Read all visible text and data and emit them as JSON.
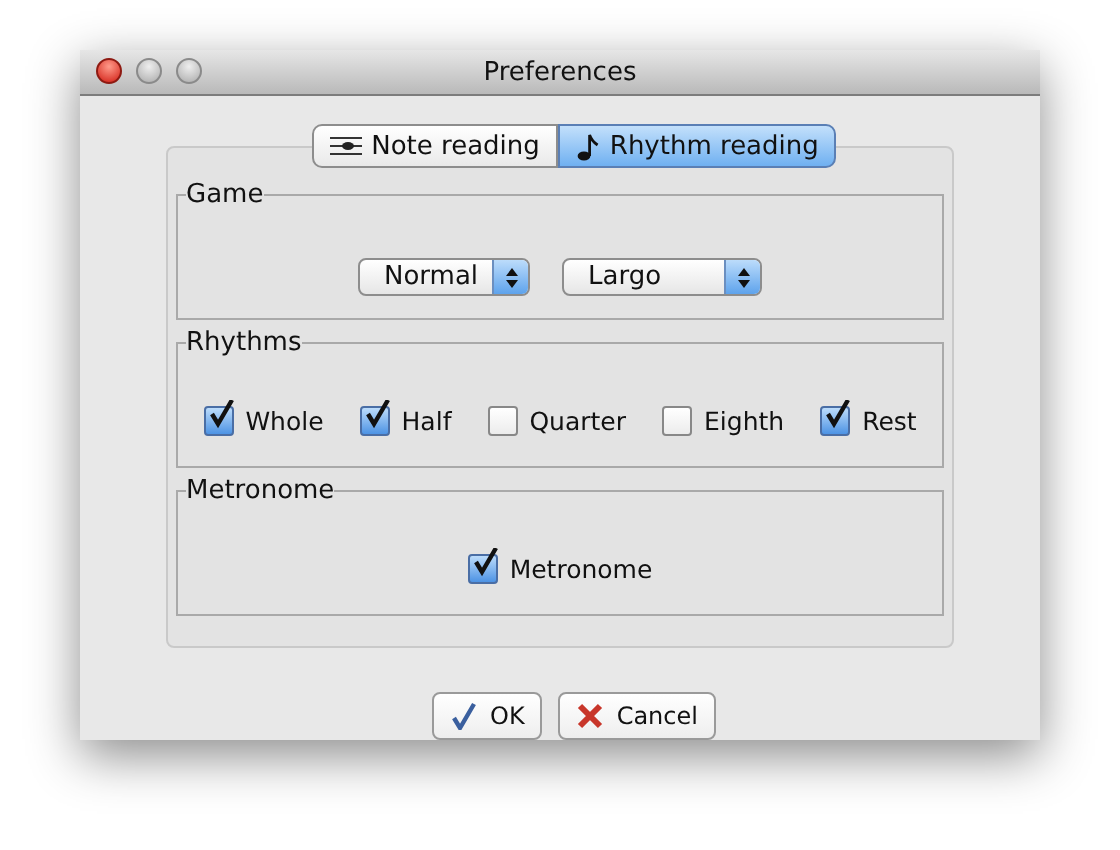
{
  "window": {
    "title": "Preferences"
  },
  "tabs": [
    {
      "label": "Note reading",
      "selected": false
    },
    {
      "label": "Rhythm reading",
      "selected": true
    }
  ],
  "groups": [
    {
      "title": "Game",
      "kind": "selects",
      "selects": [
        {
          "value": "Normal"
        },
        {
          "value": "Largo"
        }
      ]
    },
    {
      "title": "Rhythms",
      "kind": "checks",
      "checks": [
        {
          "label": "Whole",
          "checked": true
        },
        {
          "label": "Half",
          "checked": true
        },
        {
          "label": "Quarter",
          "checked": false
        },
        {
          "label": "Eighth",
          "checked": false
        },
        {
          "label": "Rest",
          "checked": true
        }
      ]
    },
    {
      "title": "Metronome",
      "kind": "checks",
      "checks": [
        {
          "label": "Metronome",
          "checked": true
        }
      ]
    }
  ],
  "buttons": [
    {
      "label": "OK",
      "kind": "ok"
    },
    {
      "label": "Cancel",
      "kind": "cancel"
    }
  ]
}
